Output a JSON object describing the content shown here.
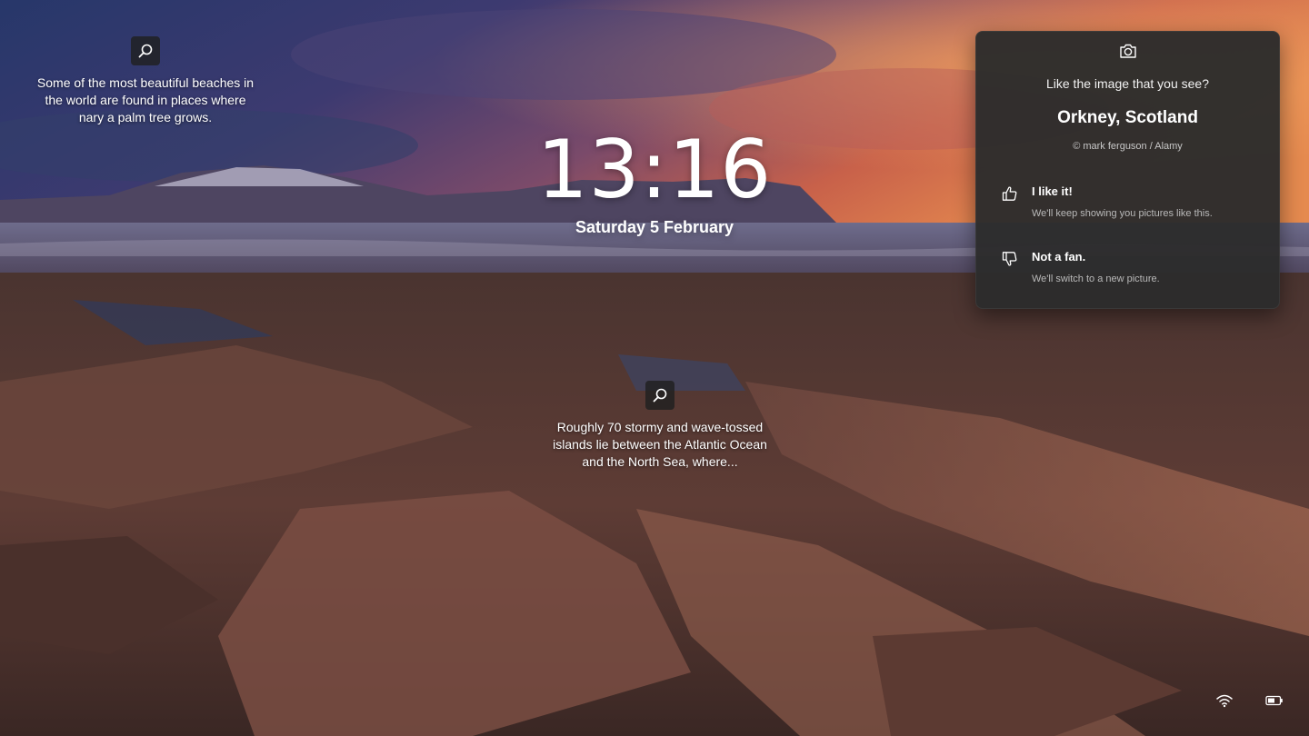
{
  "lockscreen": {
    "clock": {
      "time": "13:16",
      "date": "Saturday 5 February"
    },
    "hotspots": [
      {
        "icon": "search-icon",
        "text": "Some of the most beautiful beaches in the world are found in places where nary a palm tree grows."
      },
      {
        "icon": "search-icon",
        "text": "Roughly 70 stormy and wave-tossed islands lie between the Atlantic Ocean and the North Sea, where..."
      }
    ]
  },
  "spotlight_panel": {
    "icon": "camera-icon",
    "question": "Like the image that you see?",
    "location": "Orkney, Scotland",
    "credit": "© mark ferguson / Alamy",
    "options": [
      {
        "icon": "thumbs-up-icon",
        "title": "I like it!",
        "description": "We'll keep showing you pictures like this."
      },
      {
        "icon": "thumbs-down-icon",
        "title": "Not a fan.",
        "description": "We'll switch to a new picture."
      }
    ]
  },
  "tray": {
    "icons": [
      "wifi-icon",
      "battery-icon"
    ]
  },
  "colors": {
    "panel_background": "#2c2c2c",
    "sky_top": "#2b3a6b",
    "sky_glow": "#d0653a",
    "rock": "#5a3a34"
  }
}
